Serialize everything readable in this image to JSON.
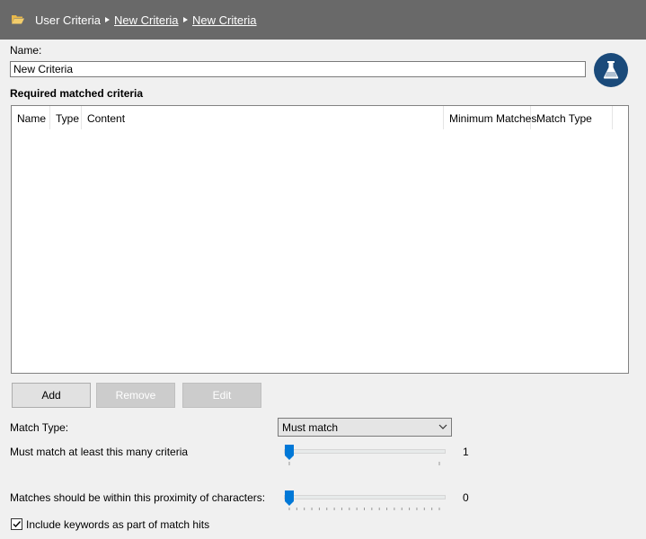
{
  "breadcrumb": {
    "root": "User Criteria",
    "items": [
      "New Criteria",
      "New Criteria"
    ]
  },
  "name": {
    "label": "Name:",
    "value": "New Criteria"
  },
  "criteria_grid": {
    "title": "Required matched criteria",
    "columns": [
      "Name",
      "Type",
      "Content",
      "Minimum Matches",
      "Match Type"
    ],
    "rows": []
  },
  "buttons": {
    "add": "Add",
    "remove": "Remove",
    "edit": "Edit"
  },
  "match_type": {
    "label": "Match Type:",
    "value": "Must match"
  },
  "min_criteria": {
    "label": "Must match at least this many criteria",
    "value": "1"
  },
  "proximity": {
    "label": "Matches should be within this proximity of characters:",
    "value": "0"
  },
  "include_keywords": {
    "label": "Include keywords as part of match hits",
    "checked": true
  },
  "colors": {
    "header": "#696969",
    "accent": "#0078d7",
    "test_button": "#1a4a7a"
  },
  "icons": {
    "folder": "folder-open-icon",
    "test": "flask-icon",
    "dropdown": "chevron-down-icon"
  }
}
